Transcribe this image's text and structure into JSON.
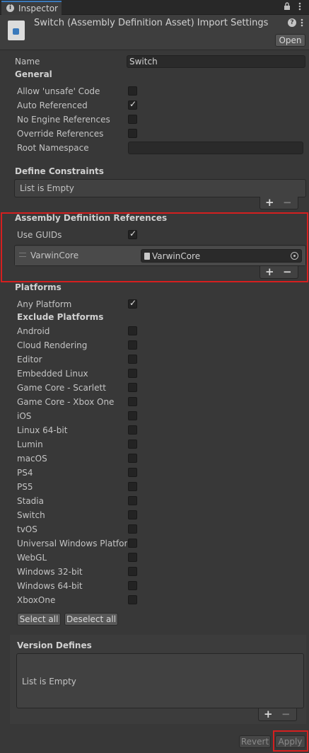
{
  "tab": {
    "icon": "info-icon",
    "label": "Inspector"
  },
  "window_buttons": {
    "lock": "lock-icon",
    "menu": "kebab-menu-icon"
  },
  "header": {
    "asset_icon": "assembly-definition-asset-icon",
    "title": "Switch (Assembly Definition Asset) Import Settings",
    "help_icon": "help-icon",
    "menu_icon": "kebab-menu-icon",
    "open_label": "Open"
  },
  "name": {
    "label": "Name",
    "value": "Switch"
  },
  "general": {
    "heading": "General",
    "items": [
      {
        "label": "Allow 'unsafe' Code",
        "checked": false
      },
      {
        "label": "Auto Referenced",
        "checked": true
      },
      {
        "label": "No Engine References",
        "checked": false
      },
      {
        "label": "Override References",
        "checked": false
      }
    ],
    "root_namespace": {
      "label": "Root Namespace",
      "value": ""
    }
  },
  "define_constraints": {
    "heading": "Define Constraints",
    "empty_text": "List is Empty",
    "add": "+",
    "remove": "−"
  },
  "assembly_refs": {
    "heading": "Assembly Definition References",
    "use_guids": {
      "label": "Use GUIDs",
      "checked": true
    },
    "item": {
      "handle": "drag-handle-icon",
      "label": "VarwinCore",
      "value": "VarwinCore",
      "value_icon": "assembly-file-icon",
      "picker_icon": "object-picker-icon"
    },
    "add": "+",
    "remove": "−"
  },
  "platforms": {
    "heading": "Platforms",
    "any_platform": {
      "label": "Any Platform",
      "checked": true
    },
    "exclude_heading": "Exclude Platforms",
    "list": [
      "Android",
      "Cloud Rendering",
      "Editor",
      "Embedded Linux",
      "Game Core - Scarlett",
      "Game Core - Xbox One",
      "iOS",
      "Linux 64-bit",
      "Lumin",
      "macOS",
      "PS4",
      "PS5",
      "Stadia",
      "Switch",
      "tvOS",
      "Universal Windows Platform",
      "WebGL",
      "Windows 32-bit",
      "Windows 64-bit",
      "XboxOne"
    ],
    "select_all": "Select all",
    "deselect_all": "Deselect all"
  },
  "version_defines": {
    "heading": "Version Defines",
    "empty_text": "List is Empty",
    "add": "+",
    "remove": "−"
  },
  "footer": {
    "revert": "Revert",
    "apply": "Apply"
  },
  "colors": {
    "highlight": "#d51f1f",
    "accent": "#3a79bb",
    "background": "#383838"
  }
}
